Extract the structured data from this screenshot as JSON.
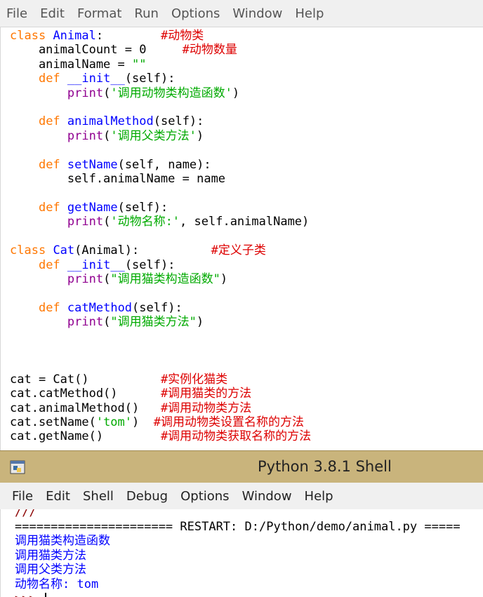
{
  "editor": {
    "menu": [
      "File",
      "Edit",
      "Format",
      "Run",
      "Options",
      "Window",
      "Help"
    ],
    "code": {
      "l1_kw": "class",
      "l1_name": "Animal",
      "l1_rest": ":        ",
      "l1_comment": "#动物类",
      "l2_code": "    animalCount = 0     ",
      "l2_comment": "#动物数量",
      "l3_code": "    animalName = ",
      "l3_str": "\"\"",
      "l4_kw": "def",
      "l4_name": "__init__",
      "l4_rest": "(self):",
      "l5_builtin": "print",
      "l5_open": "(",
      "l5_str": "'调用动物类构造函数'",
      "l5_close": ")",
      "l7_kw": "def",
      "l7_name": "animalMethod",
      "l7_rest": "(self):",
      "l8_builtin": "print",
      "l8_open": "(",
      "l8_str": "'调用父类方法'",
      "l8_close": ")",
      "l10_kw": "def",
      "l10_name": "setName",
      "l10_rest": "(self, name):",
      "l11_code": "        self.animalName = name",
      "l13_kw": "def",
      "l13_name": "getName",
      "l13_rest": "(self):",
      "l14_builtin": "print",
      "l14_open": "(",
      "l14_str": "'动物名称:'",
      "l14_rest": ", self.animalName)",
      "l16_kw": "class",
      "l16_name": "Cat",
      "l16_rest": "(Animal):          ",
      "l16_comment": "#定义子类",
      "l17_kw": "def",
      "l17_name": "__init__",
      "l17_rest": "(self):",
      "l18_builtin": "print",
      "l18_open": "(",
      "l18_str": "\"调用猫类构造函数\"",
      "l18_close": ")",
      "l20_kw": "def",
      "l20_name": "catMethod",
      "l20_rest": "(self):",
      "l21_builtin": "print",
      "l21_open": "(",
      "l21_str": "\"调用猫类方法\"",
      "l21_close": ")",
      "l25_code": "cat = Cat()          ",
      "l25_comment": "#实例化猫类",
      "l26_code": "cat.catMethod()      ",
      "l26_comment": "#调用猫类的方法",
      "l27_code": "cat.animalMethod()   ",
      "l27_comment": "#调用动物类方法",
      "l28_code": "cat.setName(",
      "l28_str": "'tom'",
      "l28_rest": ")  ",
      "l28_comment": "#调用动物类设置名称的方法",
      "l29_code": "cat.getName()        ",
      "l29_comment": "#调用动物类获取名称的方法"
    }
  },
  "shell": {
    "title": "Python 3.8.1 Shell",
    "menu": [
      "File",
      "Edit",
      "Shell",
      "Debug",
      "Options",
      "Window",
      "Help"
    ],
    "partial_line": "///",
    "restart_line": "====================== RESTART: D:/Python/demo/animal.py =====",
    "output": [
      "调用猫类构造函数",
      "调用猫类方法",
      "调用父类方法",
      "动物名称: tom"
    ],
    "prompt": ">>> "
  }
}
